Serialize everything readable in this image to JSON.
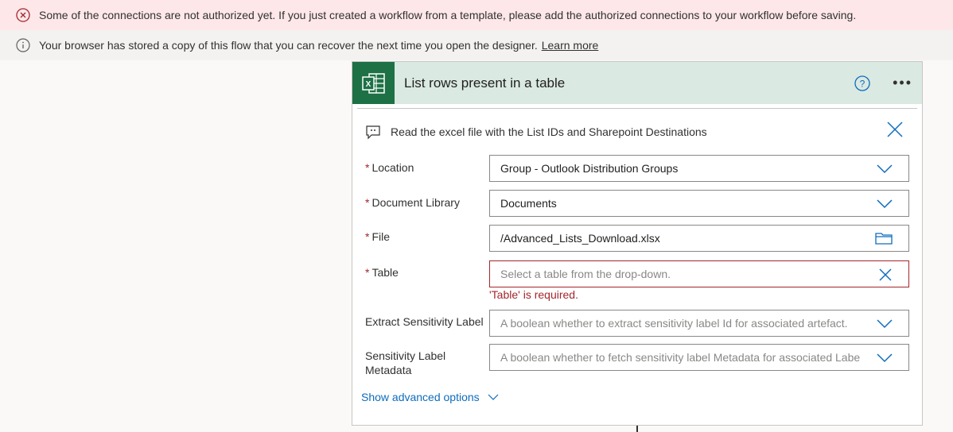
{
  "banners": {
    "error": "Some of the connections are not authorized yet. If you just created a workflow from a template, please add the authorized connections to your workflow before saving.",
    "info": "Your browser has stored a copy of this flow that you can recover the next time you open the designer.",
    "info_link": "Learn more"
  },
  "card": {
    "title": "List rows present in a table",
    "note": "Read the excel file with the List IDs and Sharepoint Destinations",
    "fields": [
      {
        "label": "Location",
        "required": "*",
        "value": "Group - Outlook Distribution Groups"
      },
      {
        "label": "Document Library",
        "required": "*",
        "value": "Documents"
      },
      {
        "label": "File",
        "required": "*",
        "value": "/Advanced_Lists_Download.xlsx"
      },
      {
        "label": "Table",
        "required": "*",
        "placeholder": "Select a table from the drop-down.",
        "error": "'Table' is required."
      },
      {
        "label": "Extract Sensitivity Label",
        "placeholder": "A boolean whether to extract sensitivity label Id for associated artefact."
      },
      {
        "label": "Sensitivity Label",
        "label2": "Metadata",
        "placeholder": "A boolean whether to fetch sensitivity label Metadata for associated Labe"
      }
    ],
    "advanced": "Show advanced options"
  },
  "colors": {
    "excel": "#1e7145",
    "accent": "#0f6cbd",
    "error": "#a4262c"
  }
}
